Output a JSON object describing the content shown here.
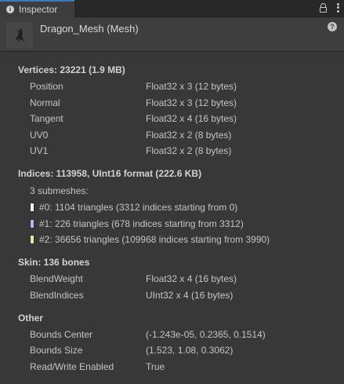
{
  "tab": {
    "icon": "info-icon",
    "label": "Inspector",
    "actions": [
      "lock-icon",
      "kebab-menu-icon"
    ]
  },
  "header": {
    "title": "Dragon_Mesh (Mesh)",
    "thumbnail": "dragon-mesh-preview",
    "help_icon": "help-icon"
  },
  "vertices": {
    "title": "Vertices: 23221 (1.9 MB)",
    "rows": [
      {
        "key": "Position",
        "value": "Float32 x 3 (12 bytes)"
      },
      {
        "key": "Normal",
        "value": "Float32 x 3 (12 bytes)"
      },
      {
        "key": "Tangent",
        "value": "Float32 x 4 (16 bytes)"
      },
      {
        "key": "UV0",
        "value": "Float32 x 2 (8 bytes)"
      },
      {
        "key": "UV1",
        "value": "Float32 x 2 (8 bytes)"
      }
    ]
  },
  "indices": {
    "title": "Indices: 113958, UInt16 format (222.6 KB)",
    "submesh_count": "3 submeshes:",
    "submeshes": [
      {
        "text": "#0: 1104 triangles (3312 indices starting from 0)",
        "color": "#f2f2f2"
      },
      {
        "text": "#1: 226 triangles (678 indices starting from 3312)",
        "color": "#b3b7ef"
      },
      {
        "text": "#2: 36656 triangles (109968 indices starting from 3990)",
        "color": "#d8eea0"
      }
    ]
  },
  "skin": {
    "title": "Skin: 136 bones",
    "rows": [
      {
        "key": "BlendWeight",
        "value": "Float32 x 4 (16 bytes)"
      },
      {
        "key": "BlendIndices",
        "value": "UInt32 x 4 (16 bytes)"
      }
    ]
  },
  "other": {
    "title": "Other",
    "rows": [
      {
        "key": "Bounds Center",
        "value": "(-1.243e-05, 0.2365, 0.1514)"
      },
      {
        "key": "Bounds Size",
        "value": "(1.523, 1.08, 0.3062)"
      },
      {
        "key": "Read/Write Enabled",
        "value": "True"
      }
    ]
  }
}
